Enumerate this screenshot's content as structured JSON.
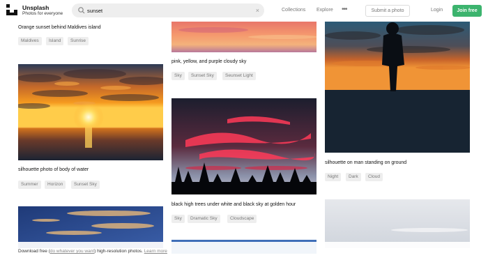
{
  "brand": {
    "name": "Unsplash",
    "tagline": "Photos for everyone"
  },
  "search": {
    "value": "sunset",
    "clear_glyph": "×"
  },
  "nav": {
    "collections": "Collections",
    "explore": "Explore",
    "more": "•••",
    "submit": "Submit a photo",
    "login": "Login",
    "join": "Join free"
  },
  "col1": {
    "photo1": {
      "caption": "Orange sunset behind Maldives island",
      "tags": [
        "Maldives",
        "Island",
        "Sunrise"
      ]
    },
    "photo2": {
      "caption": "silhouette photo of body of water",
      "tags": [
        "Summer",
        "Horizon",
        "Sunset Sky"
      ]
    }
  },
  "col2": {
    "photo1": {
      "caption": "pink, yellow, and purple cloudy sky",
      "tags": [
        "Sky",
        "Sunset Sky",
        "Seunset Light"
      ]
    },
    "photo2": {
      "caption": "black high trees under white and black sky at golden hour",
      "tags": [
        "Sky",
        "Dramatic Sky",
        "Cloudscape"
      ]
    }
  },
  "col3": {
    "photo1": {
      "caption": "silhouette on man standing on ground",
      "tags": [
        "Night",
        "Dark",
        "Cloud"
      ]
    }
  },
  "footer": {
    "prefix": "Download free (",
    "link": "do whatever you want",
    "suffix": ") high-resolution photos.",
    "learn": "Learn more"
  },
  "colors": {
    "join": "#3cb46e",
    "tag_bg": "#eeeeee",
    "tag_text": "#777777"
  }
}
